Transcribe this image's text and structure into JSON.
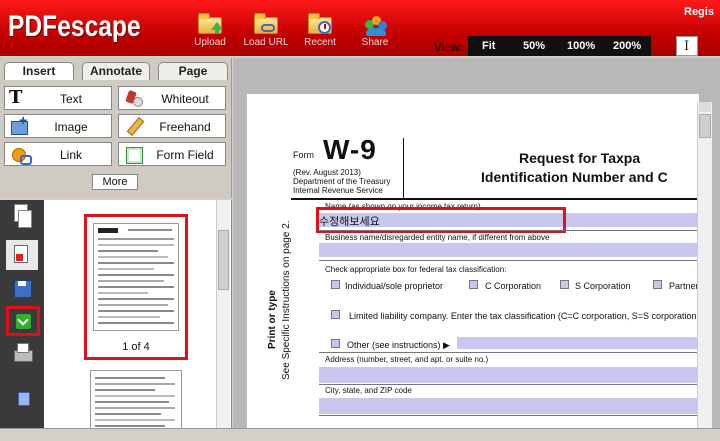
{
  "app": {
    "logo": "PDFescape",
    "register_text": "Regis"
  },
  "toolbar": {
    "items": [
      {
        "label": "Upload"
      },
      {
        "label": "Load URL"
      },
      {
        "label": "Recent"
      },
      {
        "label": "Share"
      }
    ]
  },
  "view": {
    "label": "View:",
    "zoom_options": [
      "Fit",
      "50%",
      "100%",
      "200%"
    ]
  },
  "left_tabs": [
    "Insert",
    "Annotate",
    "Page"
  ],
  "insert_tools": [
    {
      "label": "Text",
      "icon": "text-icon"
    },
    {
      "label": "Whiteout",
      "icon": "whiteout-icon"
    },
    {
      "label": "Image",
      "icon": "image-icon"
    },
    {
      "label": "Freehand",
      "icon": "freehand-icon"
    },
    {
      "label": "Link",
      "icon": "link-icon"
    },
    {
      "label": "Form Field",
      "icon": "form-field-icon"
    }
  ],
  "more_label": "More",
  "thumbnails": {
    "caption": "1 of 4"
  },
  "document": {
    "form_word": "Form",
    "form_number": "W-9",
    "rev_lines": [
      "(Rev. August 2013)",
      "Department of the Treasury",
      "Internal Revenue Service"
    ],
    "title_line1": "Request for Taxpa",
    "title_line2": "Identification Number and C",
    "side_text_1": "Print or type",
    "side_text_2": "See Specific Instructions on page 2.",
    "name_label": "Name (as shown on your income tax return)",
    "name_value": "수정해보세요",
    "business_label": "Business name/disregarded entity name, if different from above",
    "classification_label": "Check appropriate box for federal tax classification:",
    "checkboxes": [
      "Individual/sole proprietor",
      "C Corporation",
      "S Corporation",
      "Partner"
    ],
    "llc_label": "Limited liability company. Enter the tax classification (C=C corporation, S=S corporation",
    "other_label": "Other (see instructions) ▶",
    "address_label": "Address (number, street, and apt. or suite no.)",
    "city_label": "City, state, and ZIP code"
  }
}
